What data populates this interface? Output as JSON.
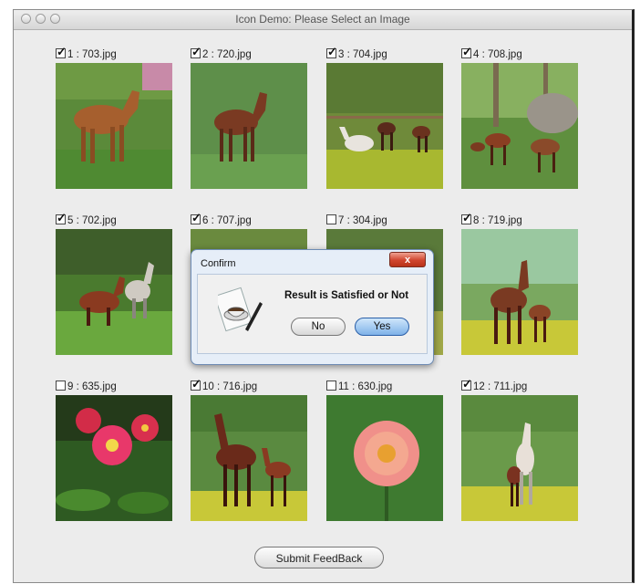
{
  "window": {
    "title": "Icon Demo: Please Select an Image"
  },
  "images": [
    {
      "label": "1 : 703.jpg",
      "checked": true
    },
    {
      "label": "2 : 720.jpg",
      "checked": true
    },
    {
      "label": "3 : 704.jpg",
      "checked": true
    },
    {
      "label": "4 : 708.jpg",
      "checked": true
    },
    {
      "label": "5 : 702.jpg",
      "checked": true
    },
    {
      "label": "6 : 707.jpg",
      "checked": true
    },
    {
      "label": "7 : 304.jpg",
      "checked": false
    },
    {
      "label": "8 : 719.jpg",
      "checked": true
    },
    {
      "label": "9 : 635.jpg",
      "checked": false
    },
    {
      "label": "10 : 716.jpg",
      "checked": true
    },
    {
      "label": "11 : 630.jpg",
      "checked": false
    },
    {
      "label": "12 : 711.jpg",
      "checked": true
    }
  ],
  "submit_label": "Submit FeedBack",
  "dialog": {
    "title": "Confirm",
    "close_label": "x",
    "message": "Result is Satisfied or Not",
    "no_label": "No",
    "yes_label": "Yes",
    "icon": "coffee-cup-pen-icon"
  },
  "colors": {
    "dialog_border": "#6d8bb3",
    "close_button": "#d0452e",
    "yes_button": "#7fb2e8"
  }
}
